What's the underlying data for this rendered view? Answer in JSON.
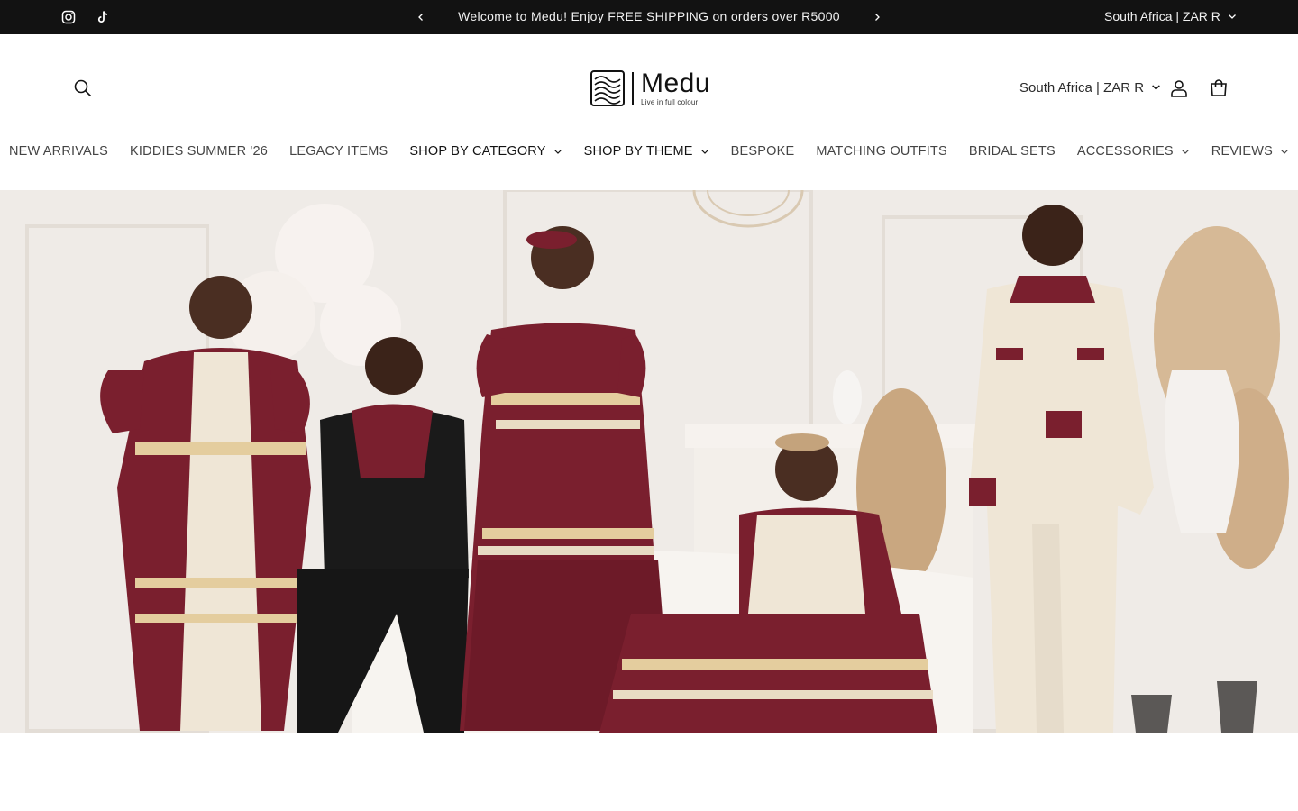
{
  "announcement": {
    "message": "Welcome to Medu! Enjoy FREE SHIPPING on orders over R5000",
    "locale": "South Africa | ZAR R",
    "icons": [
      "instagram-icon",
      "tiktok-icon",
      "chevron-left-icon",
      "chevron-right-icon"
    ]
  },
  "header": {
    "logo": {
      "name": "Medu",
      "tagline": "Live in full colour"
    },
    "locale": "South Africa | ZAR R",
    "icons": [
      "search-icon",
      "account-icon",
      "cart-icon"
    ]
  },
  "nav": {
    "items": [
      {
        "label": "NEW ARRIVALS",
        "has_dropdown": false,
        "active": false
      },
      {
        "label": "KIDDIES SUMMER '26",
        "has_dropdown": false,
        "active": false
      },
      {
        "label": "LEGACY ITEMS",
        "has_dropdown": false,
        "active": false
      },
      {
        "label": "SHOP BY CATEGORY",
        "has_dropdown": true,
        "active": true
      },
      {
        "label": "SHOP BY THEME",
        "has_dropdown": true,
        "active": true
      },
      {
        "label": "BESPOKE",
        "has_dropdown": false,
        "active": false
      },
      {
        "label": "MATCHING OUTFITS",
        "has_dropdown": false,
        "active": false
      },
      {
        "label": "BRIDAL SETS",
        "has_dropdown": false,
        "active": false
      },
      {
        "label": "ACCESSORIES",
        "has_dropdown": true,
        "active": false
      },
      {
        "label": "REVIEWS",
        "has_dropdown": true,
        "active": false
      }
    ]
  },
  "colors": {
    "announcement_bg": "#121212",
    "burgundy": "#7a1f2e",
    "cream": "#efe6d6",
    "text": "#121212"
  }
}
